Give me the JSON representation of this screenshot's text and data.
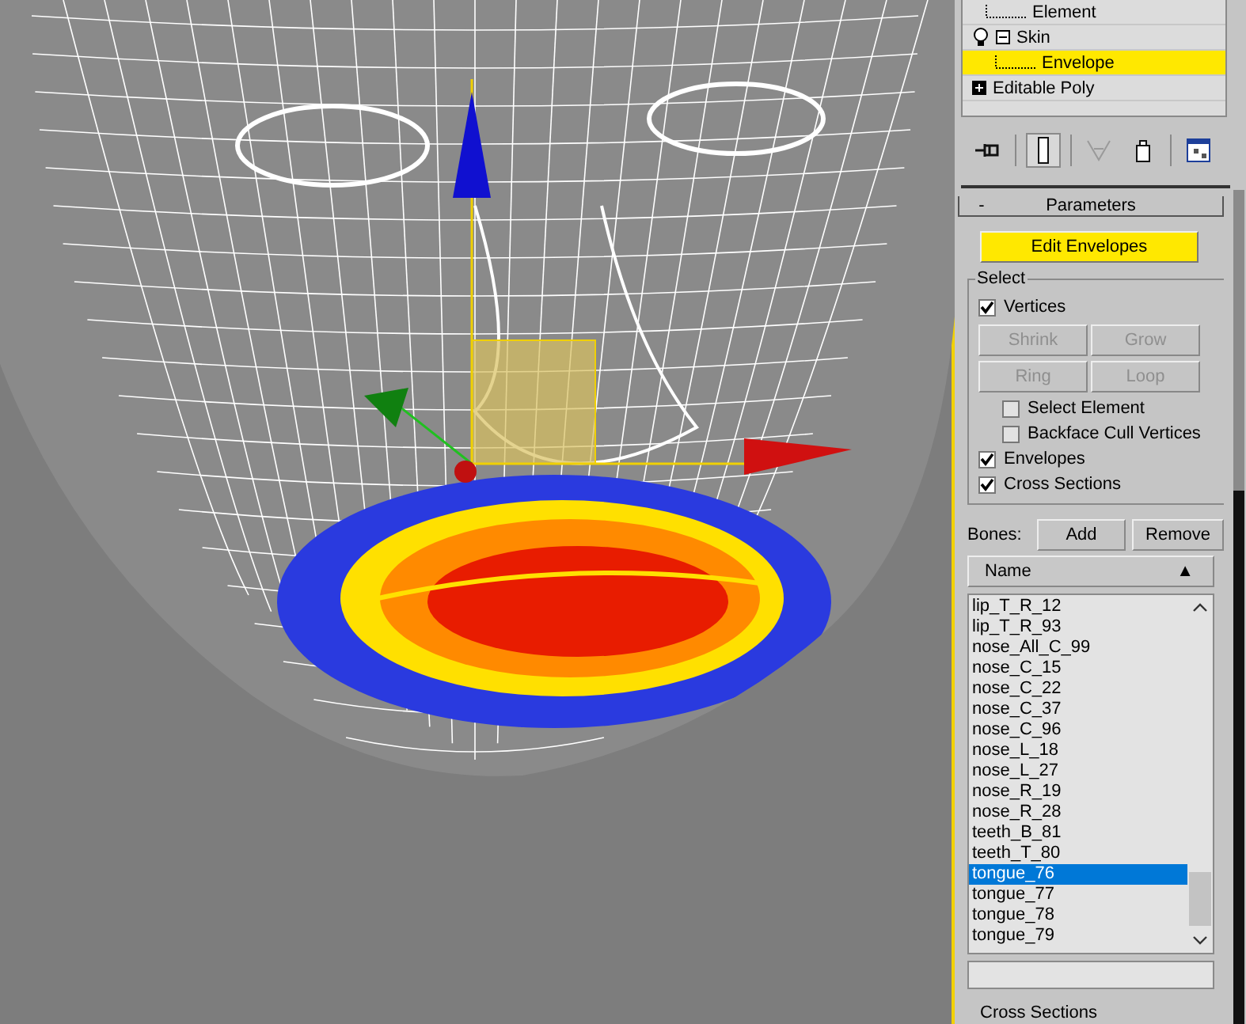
{
  "modifier_stack": [
    {
      "label": "Element",
      "kind": "sub",
      "selected": false
    },
    {
      "label": "Skin",
      "kind": "modifier",
      "expanded": true,
      "selected": false,
      "children": [
        {
          "label": "Envelope",
          "kind": "sub",
          "selected": true
        }
      ]
    },
    {
      "label": "Editable Poly",
      "kind": "base",
      "expanded": false,
      "selected": false
    }
  ],
  "toolbar": [
    {
      "kind": "pin",
      "pressed": false,
      "disabled": false
    },
    {
      "kind": "pipe",
      "pressed": true,
      "disabled": false
    },
    {
      "kind": "funnel",
      "pressed": false,
      "disabled": true
    },
    {
      "kind": "bin",
      "pressed": false,
      "disabled": false
    },
    {
      "kind": "configure",
      "pressed": false,
      "disabled": false
    }
  ],
  "parameters": {
    "title": "Parameters",
    "collapse_sign": "-",
    "edit_button": {
      "label": "Edit Envelopes",
      "on": true
    },
    "select_group": {
      "title": "Select",
      "options": [
        {
          "kind": "check",
          "label": "Vertices",
          "checked": true
        },
        {
          "kind": "buttons",
          "buttons": [
            {
              "label": "Shrink",
              "disabled": true
            },
            {
              "label": "Grow",
              "disabled": true
            }
          ]
        },
        {
          "kind": "buttons",
          "buttons": [
            {
              "label": "Ring",
              "disabled": true
            },
            {
              "label": "Loop",
              "disabled": true
            }
          ]
        },
        {
          "kind": "subcheck",
          "label": "Select Element",
          "checked": false
        },
        {
          "kind": "subcheck",
          "label": "Backface Cull Vertices",
          "checked": false
        },
        {
          "kind": "check",
          "label": "Envelopes",
          "checked": true
        },
        {
          "kind": "check",
          "label": "Cross Sections",
          "checked": true
        }
      ]
    },
    "bones": {
      "label": "Bones:",
      "add": "Add",
      "remove": "Remove",
      "column": "Name",
      "sort_sign": "▲",
      "items": [
        {
          "name": "lip_T_R_12",
          "selected": false
        },
        {
          "name": "lip_T_R_93",
          "selected": false
        },
        {
          "name": "nose_All_C_99",
          "selected": false
        },
        {
          "name": "nose_C_15",
          "selected": false
        },
        {
          "name": "nose_C_22",
          "selected": false
        },
        {
          "name": "nose_C_37",
          "selected": false
        },
        {
          "name": "nose_C_96",
          "selected": false
        },
        {
          "name": "nose_L_18",
          "selected": false
        },
        {
          "name": "nose_L_27",
          "selected": false
        },
        {
          "name": "nose_R_19",
          "selected": false
        },
        {
          "name": "nose_R_28",
          "selected": false
        },
        {
          "name": "teeth_B_81",
          "selected": false
        },
        {
          "name": "teeth_T_80",
          "selected": false
        },
        {
          "name": "tongue_76",
          "selected": true
        },
        {
          "name": "tongue_77",
          "selected": false
        },
        {
          "name": "tongue_78",
          "selected": false
        },
        {
          "name": "tongue_79",
          "selected": false
        }
      ]
    }
  },
  "next_rollout": {
    "title": "Cross Sections"
  }
}
